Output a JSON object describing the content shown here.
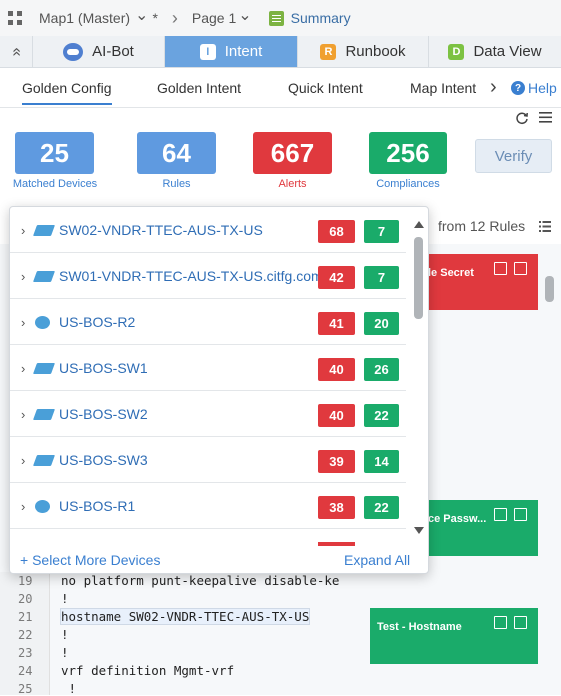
{
  "topbar": {
    "map": "Map1 (Master)",
    "map_caret": "⌄",
    "dirty": "*",
    "sep": "›",
    "page": "Page 1",
    "page_caret": "⌄",
    "summary": "Summary"
  },
  "tabs": [
    {
      "label": "AI-Bot",
      "badge": ""
    },
    {
      "label": "Intent",
      "badge": "I"
    },
    {
      "label": "Runbook",
      "badge": "R"
    },
    {
      "label": "Data View",
      "badge": "D"
    }
  ],
  "collapse_icon": "«",
  "subtabs": {
    "golden_config": "Golden Config",
    "golden_intent": "Golden Intent",
    "quick_intent": "Quick Intent",
    "map_intent": "Map Intent",
    "more": "›",
    "help": "Help"
  },
  "stats": [
    {
      "value": "25",
      "label": "Matched Devices",
      "color": "#5f9ae0"
    },
    {
      "value": "64",
      "label": "Rules",
      "color": "#5f9ae0"
    },
    {
      "value": "667",
      "label": "Alerts",
      "color": "#e0393e"
    },
    {
      "value": "256",
      "label": "Compliances",
      "color": "#1aab6a"
    }
  ],
  "verify": "Verify",
  "rules_header": "from 12 Rules",
  "cards": [
    {
      "title": "le Secret",
      "color": "red"
    },
    {
      "title": "ce Passw...",
      "color": "green"
    },
    {
      "title": "Test - Hostname",
      "color": "green"
    }
  ],
  "devices": [
    {
      "name": "SW02-VNDR-TTEC-AUS-TX-US",
      "alerts": "68",
      "compliances": "7",
      "type": "switch"
    },
    {
      "name": "SW01-VNDR-TTEC-AUS-TX-US.citfg.com",
      "alerts": "42",
      "compliances": "7",
      "type": "switch"
    },
    {
      "name": "US-BOS-R2",
      "alerts": "41",
      "compliances": "20",
      "type": "router"
    },
    {
      "name": "US-BOS-SW1",
      "alerts": "40",
      "compliances": "26",
      "type": "switch"
    },
    {
      "name": "US-BOS-SW2",
      "alerts": "40",
      "compliances": "22",
      "type": "switch"
    },
    {
      "name": "US-BOS-SW3",
      "alerts": "39",
      "compliances": "14",
      "type": "switch"
    },
    {
      "name": "US-BOS-R1",
      "alerts": "38",
      "compliances": "22",
      "type": "router"
    }
  ],
  "popup": {
    "select_more": "+ Select More Devices",
    "expand_all": "Expand All"
  },
  "code": [
    {
      "n": "19",
      "t": "no platform punt-keepalive disable-ke"
    },
    {
      "n": "20",
      "t": "!"
    },
    {
      "n": "21",
      "t": "hostname SW02-VNDR-TTEC-AUS-TX-US"
    },
    {
      "n": "22",
      "t": "!"
    },
    {
      "n": "23",
      "t": "!"
    },
    {
      "n": "24",
      "t": "vrf definition Mgmt-vrf"
    },
    {
      "n": "25",
      "t": " !"
    }
  ]
}
